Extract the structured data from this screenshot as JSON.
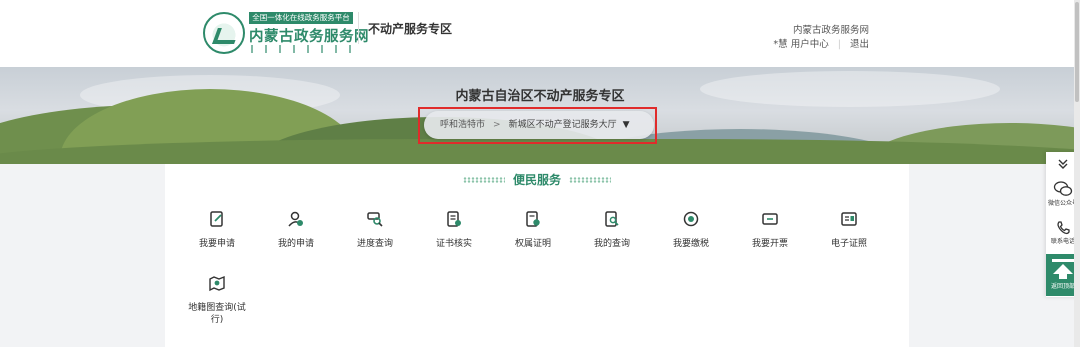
{
  "header": {
    "logo_tagline": "全国一体化在线政务服务平台",
    "logo_title": "内蒙古政务服务网",
    "section_name": "不动产服务专区",
    "site_name": "内蒙古政务服务网",
    "user_name": "*慧",
    "user_center": "用户中心",
    "logout": "退出"
  },
  "banner": {
    "title": "内蒙古自治区不动产服务专区",
    "city": "呼和浩特市",
    "separator": ">",
    "hall": "新城区不动产登记服务大厅",
    "caret": "▼"
  },
  "services_heading": "便民服务",
  "services": [
    {
      "label": "我要申请",
      "icon": "edit-document-icon"
    },
    {
      "label": "我的申请",
      "icon": "user-check-icon"
    },
    {
      "label": "进度查询",
      "icon": "progress-search-icon"
    },
    {
      "label": "证书核实",
      "icon": "certificate-check-icon"
    },
    {
      "label": "权属证明",
      "icon": "ownership-proof-icon"
    },
    {
      "label": "我的查询",
      "icon": "document-search-icon"
    },
    {
      "label": "我要缴税",
      "icon": "tax-payment-icon"
    },
    {
      "label": "我要开票",
      "icon": "invoice-ticket-icon"
    },
    {
      "label": "电子证照",
      "icon": "e-license-icon"
    },
    {
      "label": "地籍图查询(试行)",
      "icon": "cadastral-map-icon"
    }
  ],
  "float": {
    "wechat": "微信公众号",
    "phone": "联系电话",
    "back_top": "返回顶部"
  },
  "colors": {
    "brand": "#2e8a6a",
    "highlight": "#e02b2b"
  }
}
